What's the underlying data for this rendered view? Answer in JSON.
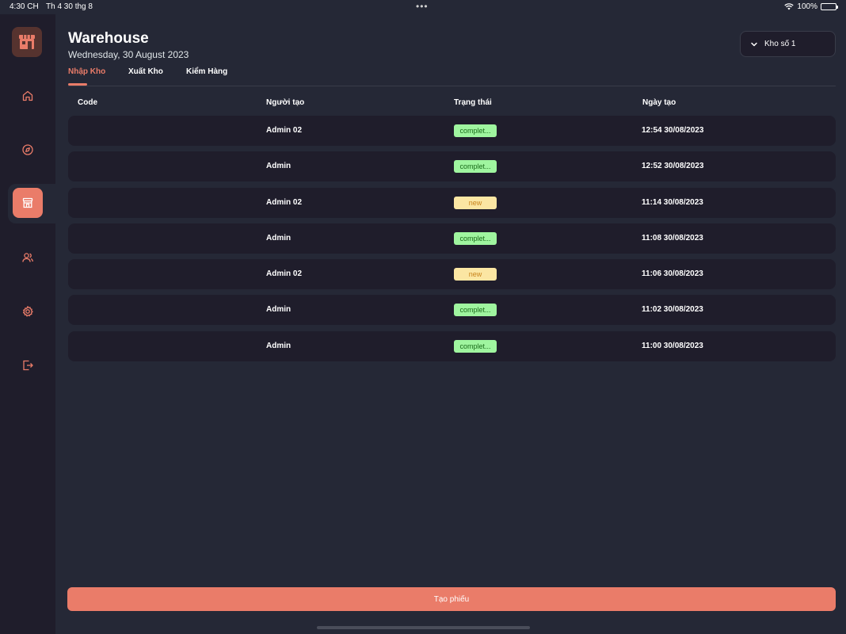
{
  "status_bar": {
    "time": "4:30 CH",
    "date": "Th 4 30 thg 8",
    "battery": "100%"
  },
  "sidebar": {
    "items": [
      {
        "icon": "store-logo-icon"
      },
      {
        "icon": "home-icon"
      },
      {
        "icon": "compass-icon"
      },
      {
        "icon": "warehouse-icon",
        "active": true
      },
      {
        "icon": "users-icon"
      },
      {
        "icon": "settings-icon"
      },
      {
        "icon": "logout-icon"
      }
    ]
  },
  "header": {
    "title": "Warehouse",
    "date": "Wednesday, 30 August 2023"
  },
  "store_select": {
    "value": "Kho số 1"
  },
  "tabs": [
    {
      "label": "Nhập Kho",
      "active": true
    },
    {
      "label": "Xuất Kho",
      "active": false
    },
    {
      "label": "Kiểm Hàng",
      "active": false
    }
  ],
  "table": {
    "columns": [
      "Code",
      "Người tạo",
      "Trạng thái",
      "Ngày tạo"
    ],
    "rows": [
      {
        "code": "",
        "creator": "Admin 02",
        "status": "complet...",
        "status_type": "completed",
        "date": "12:54 30/08/2023"
      },
      {
        "code": "",
        "creator": "Admin",
        "status": "complet...",
        "status_type": "completed",
        "date": "12:52 30/08/2023"
      },
      {
        "code": "",
        "creator": "Admin 02",
        "status": "new",
        "status_type": "new",
        "date": "11:14 30/08/2023"
      },
      {
        "code": "",
        "creator": "Admin",
        "status": "complet...",
        "status_type": "completed",
        "date": "11:08 30/08/2023"
      },
      {
        "code": "",
        "creator": "Admin 02",
        "status": "new",
        "status_type": "new",
        "date": "11:06 30/08/2023"
      },
      {
        "code": "",
        "creator": "Admin",
        "status": "complet...",
        "status_type": "completed",
        "date": "11:02 30/08/2023"
      },
      {
        "code": "",
        "creator": "Admin",
        "status": "complet...",
        "status_type": "completed",
        "date": "11:00 30/08/2023"
      }
    ]
  },
  "footer": {
    "create_label": "Tạo phiếu"
  },
  "colors": {
    "accent": "#ea7c69",
    "background": "#252836",
    "surface": "#1f1d2b",
    "completed_bg": "#9ff59f",
    "new_bg": "#fbe6a3"
  }
}
